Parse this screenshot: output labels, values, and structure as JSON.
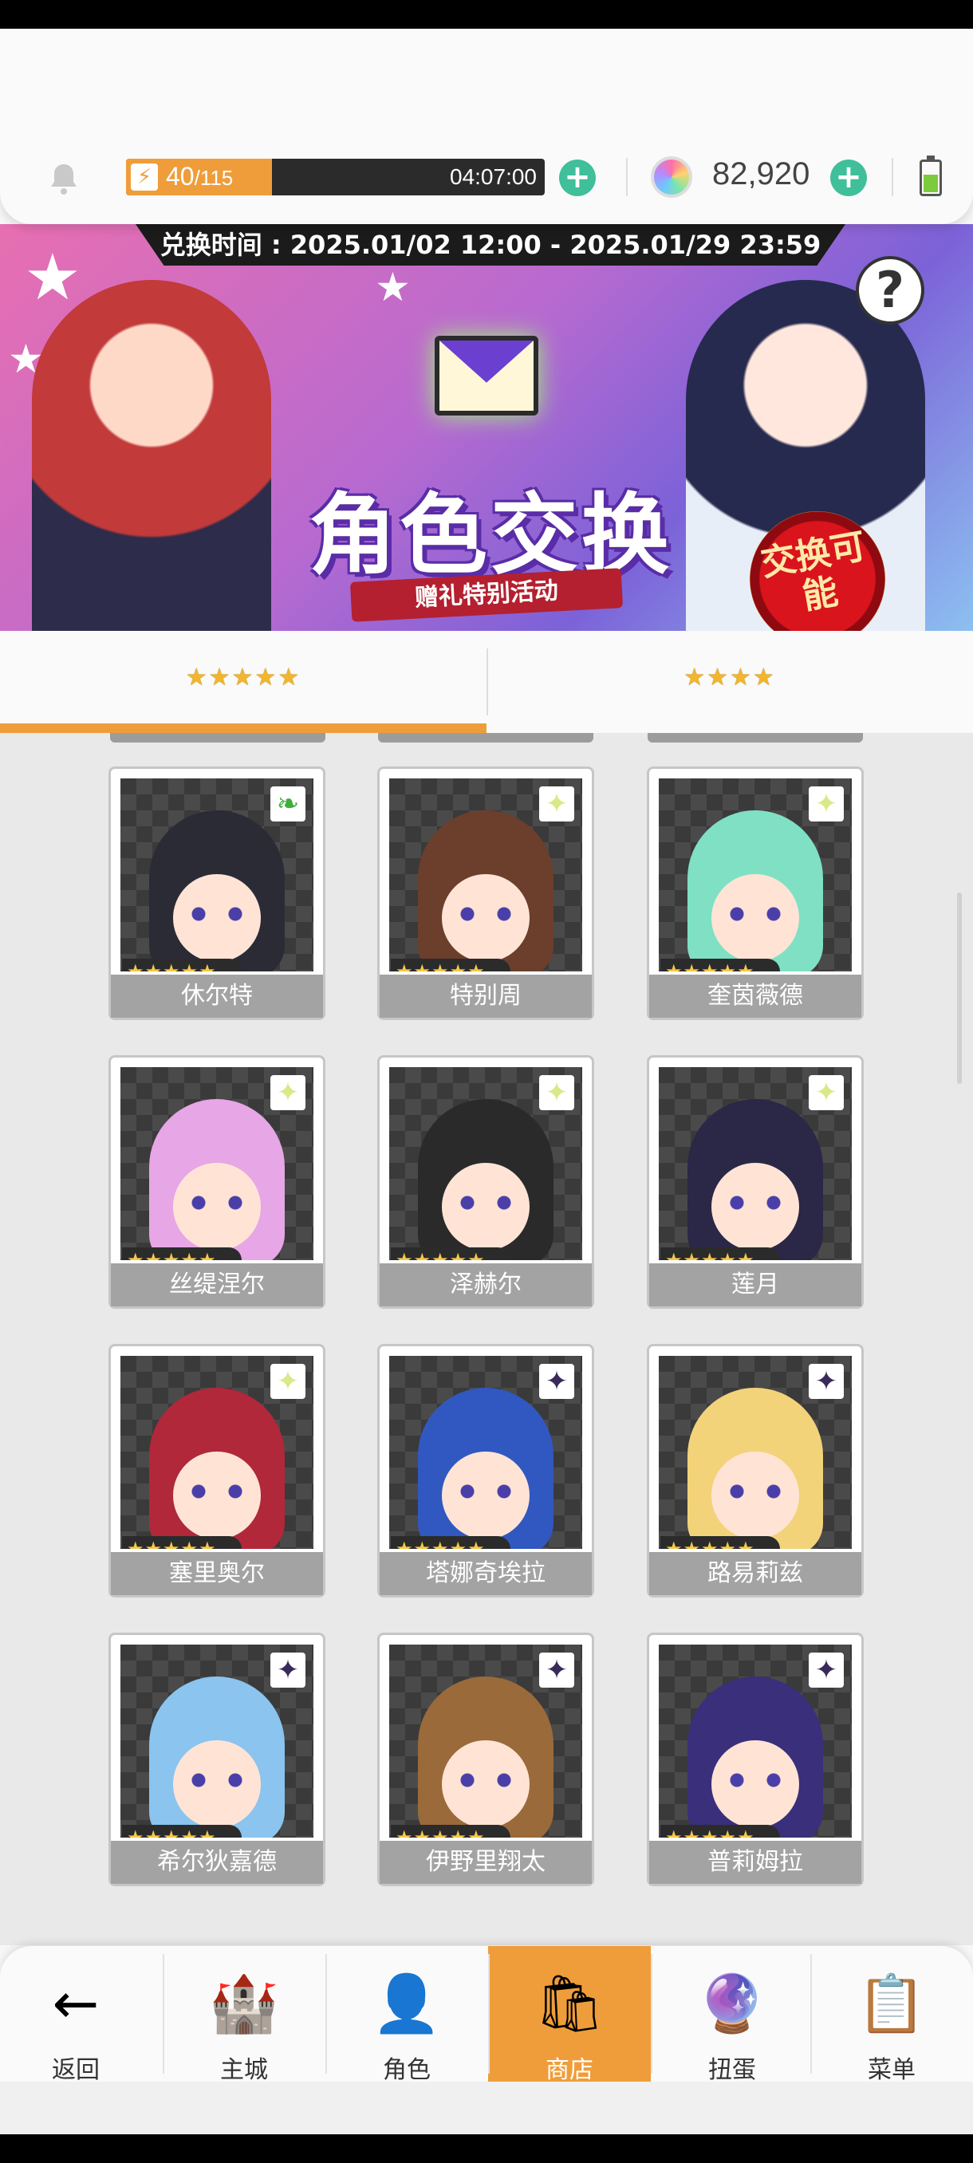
{
  "resources": {
    "stamina_current": "40",
    "stamina_max": "/115",
    "stamina_fraction": 0.348,
    "timer": "04:07:00",
    "gems": "82,920"
  },
  "banner": {
    "exchange_period": "兑换时间 : 2025.01/02 12:00 - 2025.01/29 23:59",
    "title": "角色交换",
    "subtitle": "赠礼特别活动",
    "badge": "交换可能",
    "help": "?"
  },
  "tabs": [
    {
      "label": "★★★★★",
      "active": true
    },
    {
      "label": "★★★★",
      "active": false
    }
  ],
  "characters": [
    {
      "name": "休尔特",
      "stars": "★★★★★",
      "element": "leaf-icon",
      "hair": "#2b2b36"
    },
    {
      "name": "特别周",
      "stars": "★★★★★",
      "element": "sparkle-icon",
      "hair": "#6b3f2c"
    },
    {
      "name": "奎茵薇德",
      "stars": "★★★★★",
      "element": "sparkle-icon",
      "hair": "#7fe0c4"
    },
    {
      "name": "丝缇涅尔",
      "stars": "★★★★★",
      "element": "sparkle-icon",
      "hair": "#e7a6e6"
    },
    {
      "name": "泽赫尔",
      "stars": "★★★★★",
      "element": "sparkle-icon",
      "hair": "#2a2a2a"
    },
    {
      "name": "莲月",
      "stars": "★★★★★",
      "element": "sparkle-icon",
      "hair": "#2b2746"
    },
    {
      "name": "塞里奥尔",
      "stars": "★★★★★",
      "element": "sparkle-icon",
      "hair": "#b0283a"
    },
    {
      "name": "塔娜奇埃拉",
      "stars": "★★★★★",
      "element": "dark-star-icon",
      "hair": "#3158c0"
    },
    {
      "name": "路易莉兹",
      "stars": "★★★★★",
      "element": "dark-star-icon",
      "hair": "#f3d37a"
    },
    {
      "name": "希尔狄嘉德",
      "stars": "★★★★★",
      "element": "dark-star-icon",
      "hair": "#8ac4ef"
    },
    {
      "name": "伊野里翔太",
      "stars": "★★★★★",
      "element": "dark-star-icon",
      "hair": "#9a6a3a"
    },
    {
      "name": "普莉姆拉",
      "stars": "★★★★★",
      "element": "dark-star-icon",
      "hair": "#3a2f7a"
    }
  ],
  "nav": [
    {
      "label": "返回",
      "icon": "back-arrow-icon",
      "glyph": "←"
    },
    {
      "label": "主城",
      "icon": "castle-icon",
      "glyph": "🏰"
    },
    {
      "label": "角色",
      "icon": "character-icon",
      "glyph": "👤"
    },
    {
      "label": "商店",
      "icon": "shop-icon",
      "glyph": "🛍",
      "active": true
    },
    {
      "label": "扭蛋",
      "icon": "gacha-icon",
      "glyph": "🔮"
    },
    {
      "label": "菜单",
      "icon": "menu-icon",
      "glyph": "📋"
    }
  ],
  "colors": {
    "accent": "#ef9d3a",
    "plus": "#3fbf9a",
    "star": "#f7c945"
  }
}
